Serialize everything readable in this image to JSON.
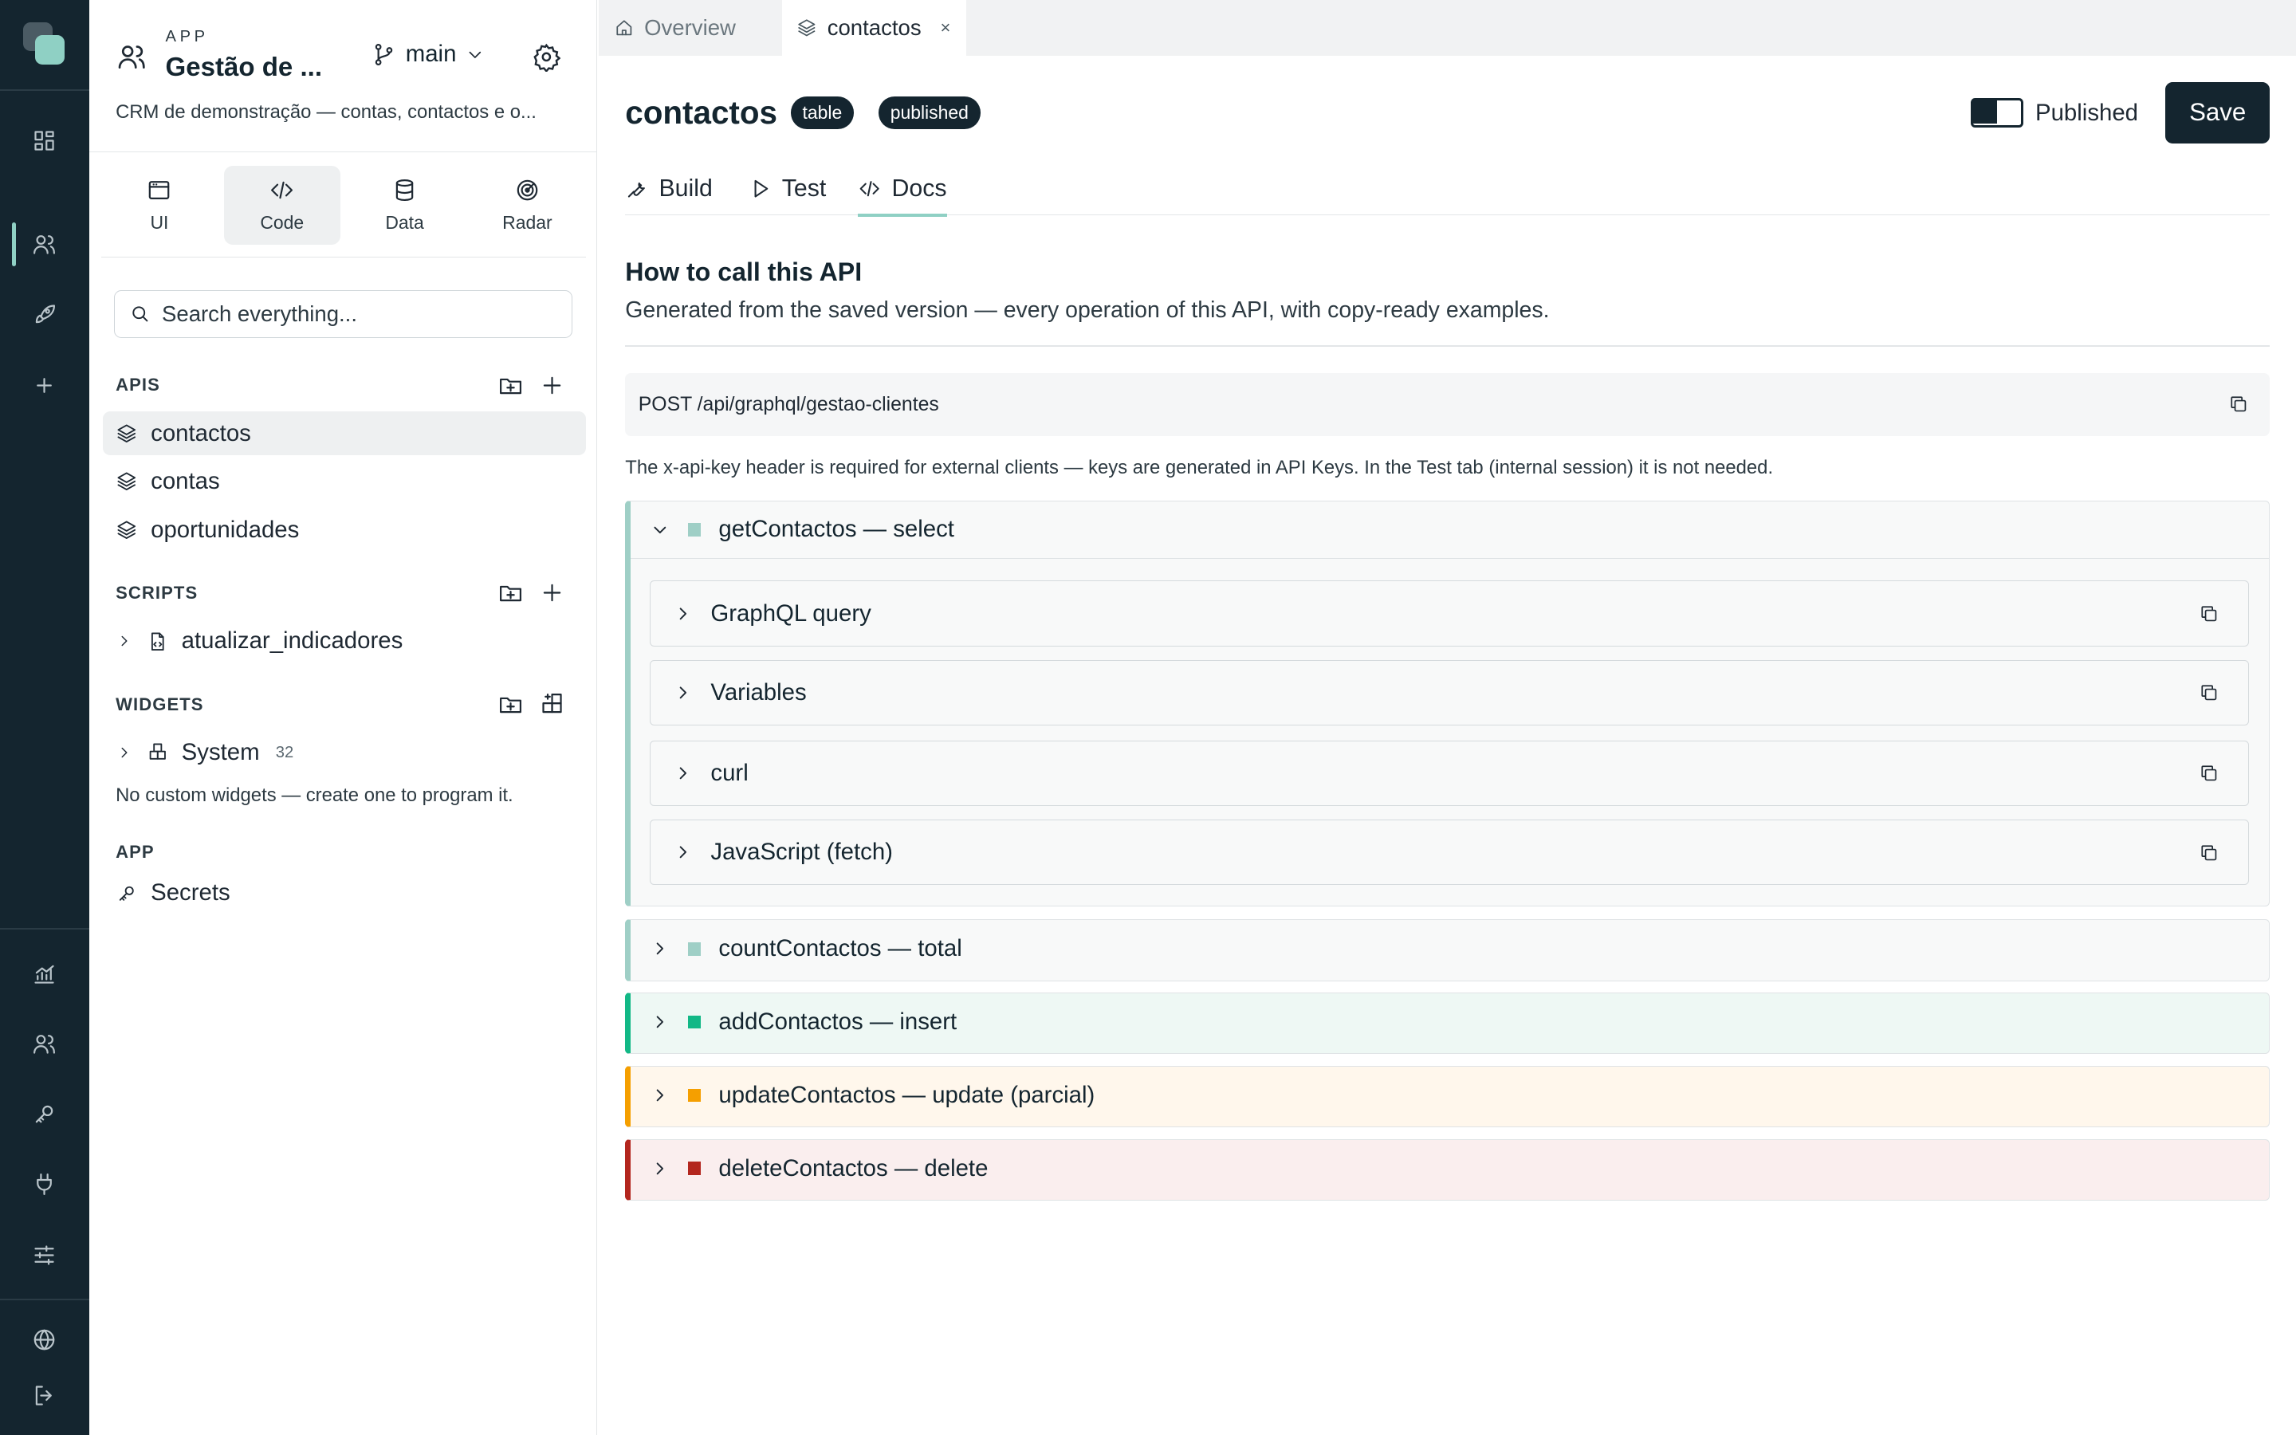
{
  "app": {
    "kicker": "APP",
    "title": "Gestão de ...",
    "branch": "main",
    "description": "CRM de demonstração — contas, contactos e o..."
  },
  "modes": [
    {
      "label": "UI",
      "icon": "window-icon"
    },
    {
      "label": "Code",
      "icon": "code-icon",
      "active": true
    },
    {
      "label": "Data",
      "icon": "database-icon"
    },
    {
      "label": "Radar",
      "icon": "radar-icon"
    }
  ],
  "search": {
    "placeholder": "Search everything..."
  },
  "sidebar": {
    "apis_header": "APIS",
    "apis": [
      "contactos",
      "contas",
      "oportunidades"
    ],
    "scripts_header": "SCRIPTS",
    "scripts": [
      "atualizar_indicadores"
    ],
    "widgets_header": "WIDGETS",
    "widgets_group": {
      "label": "System",
      "count": "32"
    },
    "widgets_note": "No custom widgets — create one to program it.",
    "app_header": "APP",
    "app_items": [
      "Secrets"
    ]
  },
  "file_tabs": [
    {
      "label": "Overview",
      "icon": "home-icon"
    },
    {
      "label": "contactos",
      "icon": "layers-icon",
      "close": "×"
    }
  ],
  "page": {
    "title": "contactos",
    "badges": [
      "table",
      "published"
    ],
    "toggle_label": "Published",
    "toggle_on": true,
    "save_label": "Save"
  },
  "sub_tabs": [
    {
      "label": "Build",
      "icon": "wrench-icon"
    },
    {
      "label": "Test",
      "icon": "play-icon"
    },
    {
      "label": "Docs",
      "icon": "code-icon",
      "active": true
    }
  ],
  "docs": {
    "heading": "How to call this API",
    "subheading": "Generated from the saved version — every operation of this API, with copy-ready examples.",
    "endpoint": "POST /api/graphql/gestao-clientes",
    "note": "The x-api-key header is required for external clients — keys are generated in API Keys. In the Test tab (internal session) it is not needed."
  },
  "operations": [
    {
      "label": "getContactos — select",
      "color": "#9fcfc6",
      "square": "#9fcfc6",
      "bg": "#f8f9f9",
      "open": true,
      "panels": [
        "GraphQL query",
        "Variables",
        "curl",
        "JavaScript (fetch)"
      ]
    },
    {
      "label": "countContactos — total",
      "color": "#9fcfc6",
      "square": "#9fcfc6",
      "bg": "#f8f9f9"
    },
    {
      "label": "addContactos — insert",
      "color": "#12b886",
      "square": "#12b886",
      "bg": "#eef8f4"
    },
    {
      "label": "updateContactos — update (parcial)",
      "color": "#f59f00",
      "square": "#f59f00",
      "bg": "#fff7ec"
    },
    {
      "label": "deleteContactos — delete",
      "color": "#b3261e",
      "square": "#b3261e",
      "bg": "#faeeee"
    }
  ]
}
